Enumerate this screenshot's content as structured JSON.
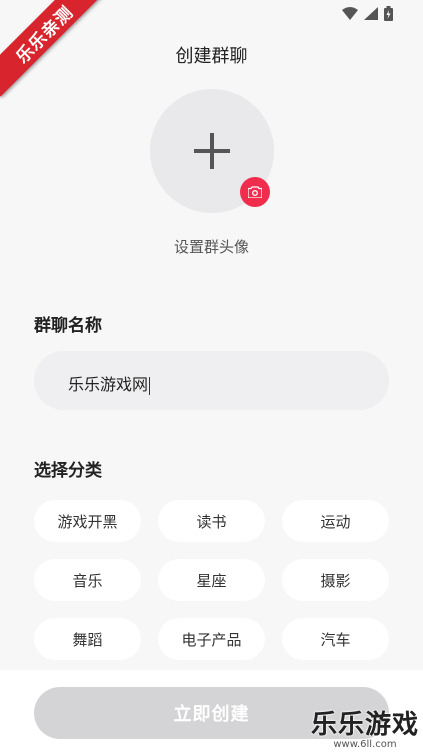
{
  "ribbon": {
    "text": "乐乐亲测"
  },
  "header": {
    "title": "创建群聊"
  },
  "avatar": {
    "caption": "设置群头像"
  },
  "name_section": {
    "label": "群聊名称",
    "value": "乐乐游戏网"
  },
  "category_section": {
    "label": "选择分类",
    "options": [
      "游戏开黑",
      "读书",
      "运动",
      "音乐",
      "星座",
      "摄影",
      "舞蹈",
      "电子产品",
      "汽车"
    ]
  },
  "footer": {
    "create_label": "立即创建"
  },
  "watermark": {
    "title": "乐乐游戏",
    "url": "www.6ll.com"
  },
  "colors": {
    "accent": "#f12d4d",
    "ribbon": "#d8242d",
    "button_disabled": "#d4d4d6"
  }
}
